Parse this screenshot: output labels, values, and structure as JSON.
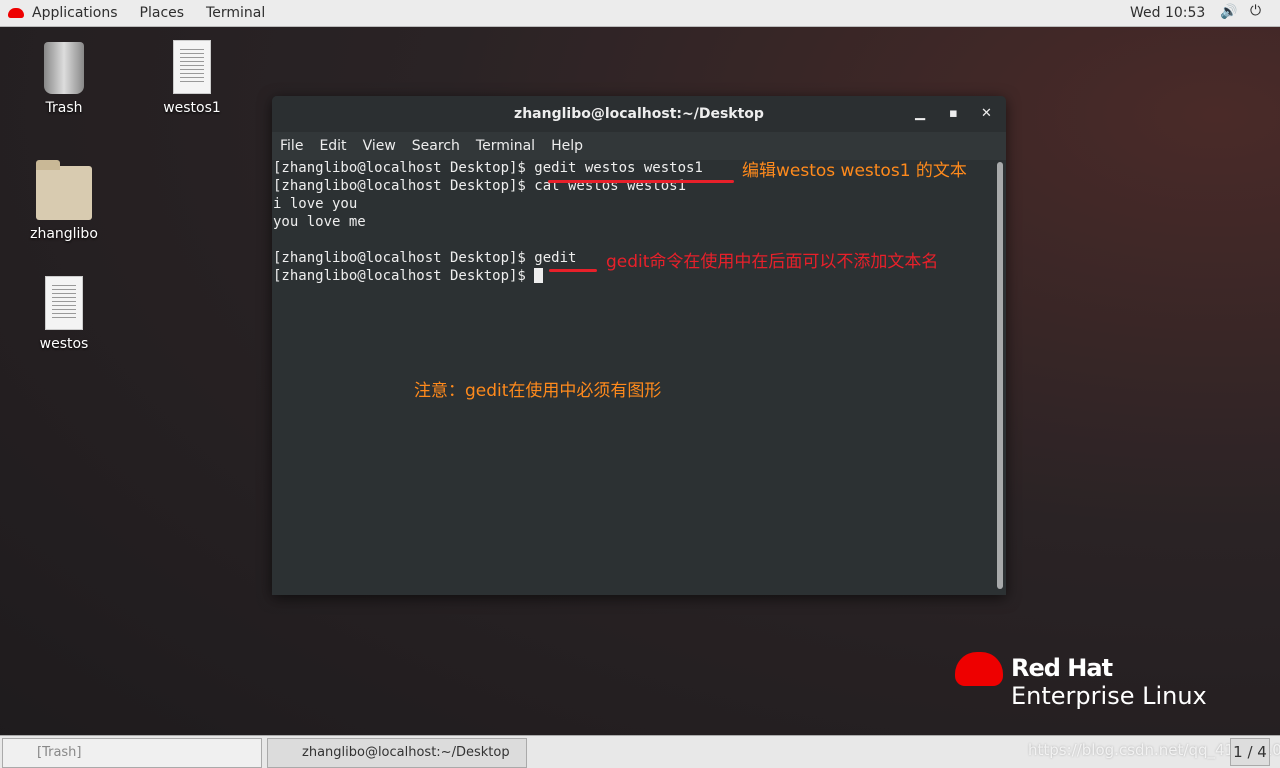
{
  "topbar": {
    "applications": "Applications",
    "places": "Places",
    "terminal": "Terminal",
    "clock": "Wed 10:53"
  },
  "desktop": {
    "icons": [
      {
        "label": "Trash"
      },
      {
        "label": "westos1"
      },
      {
        "label": "zhanglibo"
      },
      {
        "label": "westos"
      }
    ]
  },
  "terminal": {
    "title": "zhanglibo@localhost:~/Desktop",
    "menu": [
      "File",
      "Edit",
      "View",
      "Search",
      "Terminal",
      "Help"
    ],
    "lines": [
      "[zhanglibo@localhost Desktop]$ gedit westos westos1",
      "[zhanglibo@localhost Desktop]$ cat westos westos1",
      "i love you",
      "you love me",
      "",
      "[zhanglibo@localhost Desktop]$ gedit",
      "[zhanglibo@localhost Desktop]$ "
    ]
  },
  "annotations": {
    "a1": "编辑westos  westos1 的文本",
    "a2": "gedit命令在使用中在后面可以不添加文本名",
    "a3": "注意：gedit在使用中必须有图形",
    "orange": "#ff8a1c",
    "red": "#e8202a"
  },
  "logo": {
    "line1": "Red Hat",
    "line2": "Enterprise Linux"
  },
  "taskbar": {
    "task1": "[Trash]",
    "task2": "zhanglibo@localhost:~/Desktop",
    "watermark": "https://blog.csdn.net/qq_41537102",
    "workspace": "1 / 4"
  }
}
